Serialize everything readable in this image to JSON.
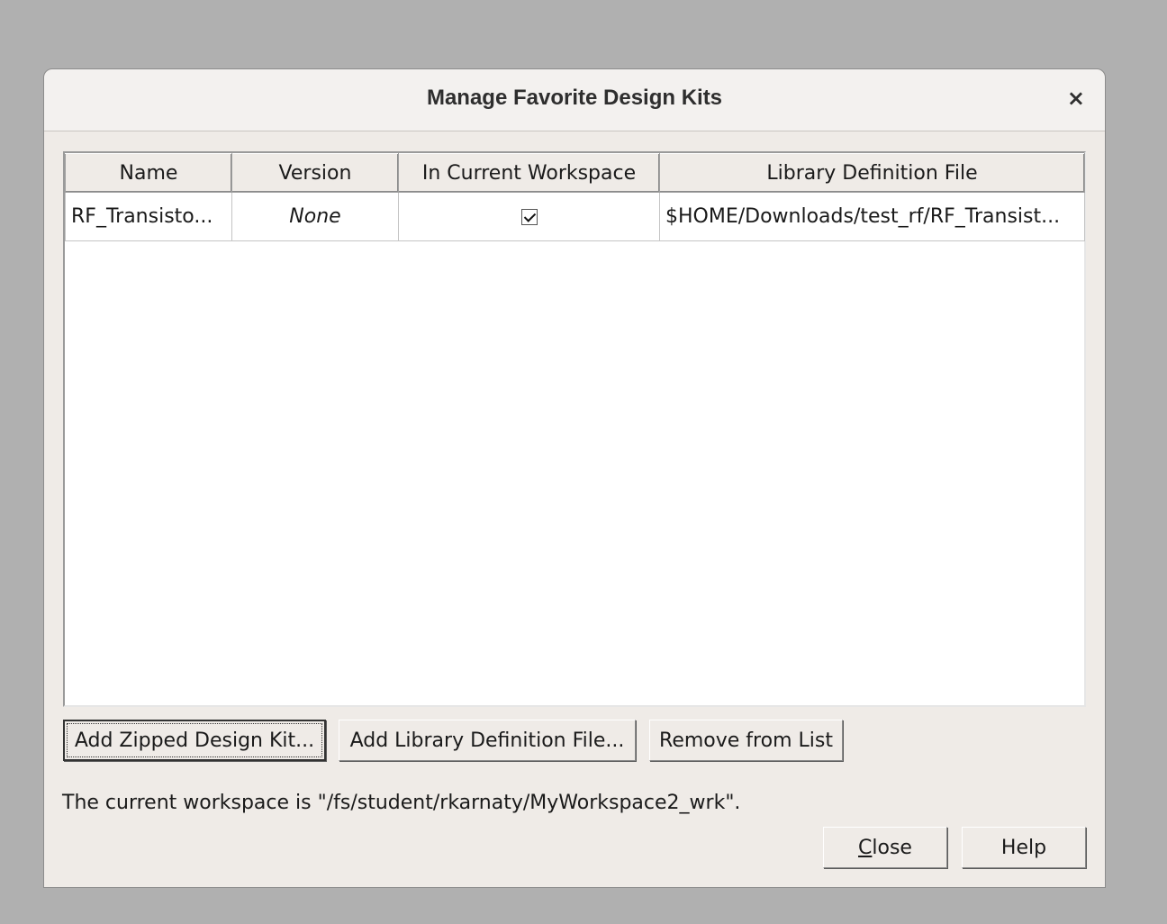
{
  "dialog": {
    "title": "Manage Favorite Design Kits",
    "close_symbol": "×"
  },
  "table": {
    "columns": [
      "Name",
      "Version",
      "In Current Workspace",
      "Library Definition File"
    ],
    "rows": [
      {
        "name": "RF_Transisto...",
        "version": "None",
        "in_current_workspace": true,
        "library_definition_file": "$HOME/Downloads/test_rf/RF_Transist..."
      }
    ]
  },
  "buttons": {
    "add_zipped": "Add Zipped Design Kit...",
    "add_library": "Add Library Definition File...",
    "remove": "Remove from List",
    "close_mnemonic": "C",
    "close_rest": "lose",
    "help": "Help"
  },
  "status": {
    "text": "The current workspace is \"/fs/student/rkarnaty/MyWorkspace2_wrk\"."
  },
  "colors": {
    "background": "#b0b0b0",
    "dialog": "#efebe7",
    "table_bg": "#ffffff"
  }
}
